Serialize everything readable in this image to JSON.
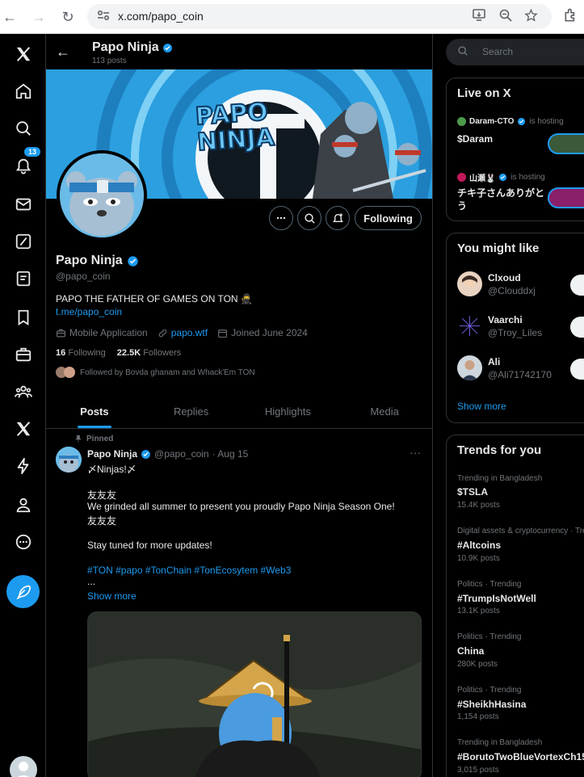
{
  "browser": {
    "url": "x.com/papo_coin",
    "back_glyph": "←",
    "forward_glyph": "→",
    "reload_glyph": "↻"
  },
  "rail": {
    "notifications_badge": "13"
  },
  "header": {
    "name": "Papo Ninja",
    "posts_count": "113 posts"
  },
  "banner": {
    "line1": "PAPO",
    "line2": "NINJA"
  },
  "profile": {
    "name": "Papo Ninja",
    "handle": "@papo_coin",
    "bio": "PAPO THE FATHER OF GAMES ON TON 🥷",
    "link": "t.me/papo_coin",
    "category": "Mobile Application",
    "website": "papo.wtf",
    "joined": "Joined June 2024",
    "following_count": "16",
    "following_label": "Following",
    "followers_count": "22.5K",
    "followers_label": "Followers",
    "followed_by": "Followed by Bovda ghanam and Whack'Em TON",
    "follow_button": "Following"
  },
  "tabs": [
    "Posts",
    "Replies",
    "Highlights",
    "Media"
  ],
  "pinned_tweet": {
    "pinned_label": "Pinned",
    "author": "Papo Ninja",
    "handle": "@papo_coin",
    "date": "· Aug 15",
    "lines": [
      "〆Ninjas!〆",
      "",
      "友友友",
      "We grinded all summer to present you proudly Papo Ninja Season One!",
      "友友友",
      "",
      "Stay tuned for more updates!"
    ],
    "hashtags": "#TON #papo #TonChain #TonEcosytem #Web3",
    "ellipsis": "...",
    "show_more": "Show more"
  },
  "right": {
    "search_placeholder": "Search",
    "live": {
      "title": "Live on X",
      "items": [
        {
          "host": "Daram-CTO",
          "status": "is hosting",
          "title": "$Daram"
        },
        {
          "host": "山瀬🐰",
          "status": "is hosting",
          "title": "チキ子さんありがとう"
        }
      ]
    },
    "who_to_follow": {
      "title": "You might like",
      "users": [
        {
          "name": "Clxoud",
          "handle": "@Clouddxj"
        },
        {
          "name": "Vaarchi",
          "handle": "@Troy_Liles"
        },
        {
          "name": "Ali",
          "handle": "@Ali71742170"
        }
      ],
      "show_more": "Show more"
    },
    "trends": {
      "title": "Trends for you",
      "items": [
        {
          "meta": "Trending in Bangladesh",
          "name": "$TSLA",
          "count": "15.4K posts"
        },
        {
          "meta": "Digital assets & cryptocurrency · Trending",
          "name": "#Altcoins",
          "count": "10.9K posts"
        },
        {
          "meta": "Politics · Trending",
          "name": "#TrumpIsNotWell",
          "count": "13.1K posts"
        },
        {
          "meta": "Politics · Trending",
          "name": "China",
          "count": "280K posts"
        },
        {
          "meta": "Politics · Trending",
          "name": "#SheikhHasina",
          "count": "1,154 posts"
        },
        {
          "meta": "Trending in Bangladesh",
          "name": "#BorutoTwoBlueVortexCh15",
          "count": "3,015 posts"
        }
      ]
    }
  },
  "colors": {
    "accent": "#1d9bf0",
    "background": "#000000",
    "border": "#2f3336",
    "muted": "#71767b"
  }
}
